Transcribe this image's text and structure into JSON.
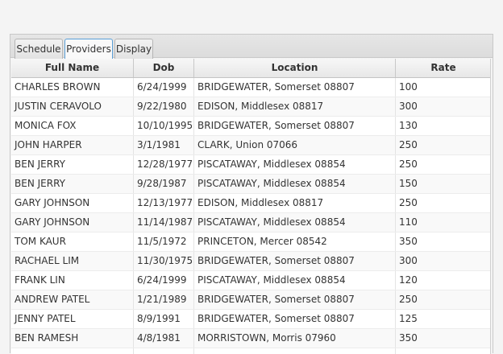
{
  "tabs": [
    {
      "label": "Schedule",
      "selected": false
    },
    {
      "label": "Providers",
      "selected": true
    },
    {
      "label": "Display",
      "selected": false
    }
  ],
  "table": {
    "columns": [
      "Full Name",
      "Dob",
      "Location",
      "Rate"
    ],
    "rows": [
      [
        "CHARLES BROWN",
        "6/24/1999",
        "BRIDGEWATER, Somerset 08807",
        "100"
      ],
      [
        "JUSTIN CERAVOLO",
        "9/22/1980",
        "EDISON, Middlesex 08817",
        "300"
      ],
      [
        "MONICA FOX",
        "10/10/1995",
        "BRIDGEWATER, Somerset 08807",
        "130"
      ],
      [
        "JOHN HARPER",
        "3/1/1981",
        "CLARK, Union 07066",
        "250"
      ],
      [
        "BEN JERRY",
        "12/28/1977",
        "PISCATAWAY, Middlesex 08854",
        "250"
      ],
      [
        "BEN JERRY",
        "9/28/1987",
        "PISCATAWAY, Middlesex 08854",
        "150"
      ],
      [
        "GARY JOHNSON",
        "12/13/1977",
        "EDISON, Middlesex 08817",
        "250"
      ],
      [
        "GARY JOHNSON",
        "11/14/1987",
        "PISCATAWAY, Middlesex 08854",
        "110"
      ],
      [
        "TOM KAUR",
        "11/5/1972",
        "PRINCETON, Mercer 08542",
        "350"
      ],
      [
        "RACHAEL LIM",
        "11/30/1975",
        "BRIDGEWATER, Somerset 08807",
        "300"
      ],
      [
        "FRANK LIN",
        "6/24/1999",
        "PISCATAWAY, Middlesex 08854",
        "120"
      ],
      [
        "ANDREW PATEL",
        "1/21/1989",
        "BRIDGEWATER, Somerset 08807",
        "250"
      ],
      [
        "JENNY PATEL",
        "8/9/1991",
        "BRIDGEWATER, Somerset 08807",
        "125"
      ],
      [
        "BEN RAMESH",
        "4/8/1981",
        "MORRISTOWN, Morris 07960",
        "350"
      ],
      [
        "",
        "",
        "",
        ""
      ]
    ]
  }
}
